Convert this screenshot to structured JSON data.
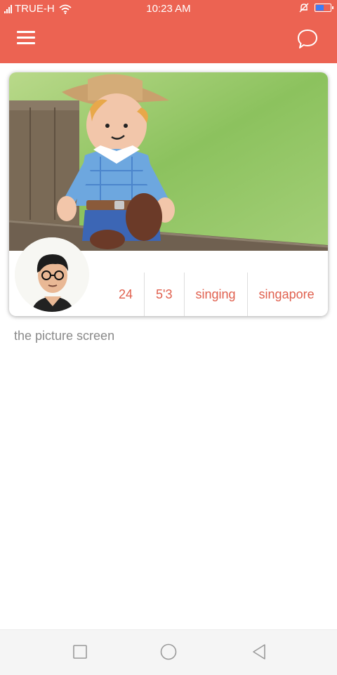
{
  "status_bar": {
    "carrier": "TRUE-H",
    "time": "10:23 AM",
    "battery_level": 0.55,
    "icons": [
      "signal-icon",
      "wifi-icon",
      "mute-icon",
      "battery-icon"
    ]
  },
  "header": {
    "background_color": "#ec6352",
    "menu_icon": "hamburger-menu-icon",
    "chat_icon": "chat-bubble-icon"
  },
  "profile_card": {
    "stats": [
      "24",
      "5'3",
      "singing",
      "singapore"
    ],
    "accent_color": "#e0604e"
  },
  "caption": "the picture screen",
  "nav_bar": {
    "icons": [
      "recent-apps-icon",
      "home-icon",
      "back-icon"
    ]
  }
}
